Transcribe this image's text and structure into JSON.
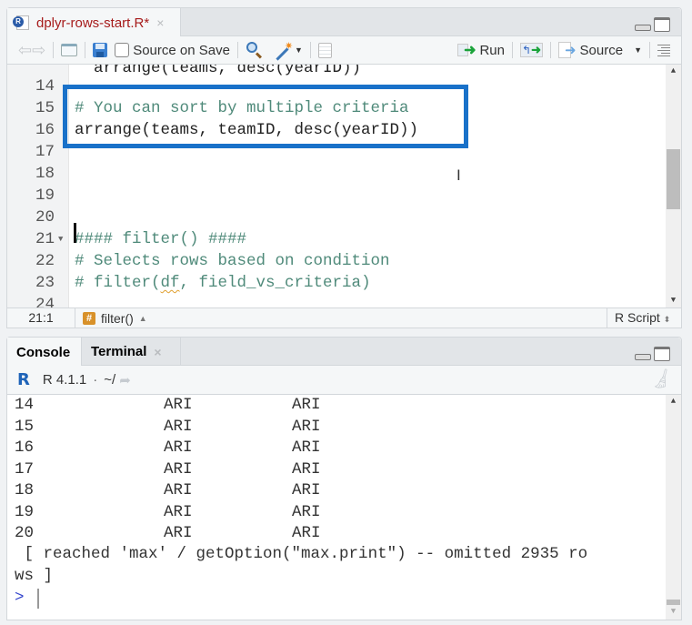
{
  "editor": {
    "tab": {
      "filename": "dplyr-rows-start.R*",
      "close_icon": "×",
      "file_color": "#a61b1b"
    },
    "toolbar": {
      "source_on_save_label": "Source on Save",
      "source_on_save_checked": false,
      "run_label": "Run",
      "source_label": "Source"
    },
    "lines": [
      {
        "n": "14",
        "text": "",
        "kind": "plain"
      },
      {
        "n": "15",
        "text": "# You can sort by multiple criteria",
        "kind": "comment"
      },
      {
        "n": "16",
        "text": "arrange(teams, teamID, desc(yearID))",
        "kind": "plain"
      },
      {
        "n": "17",
        "text": "",
        "kind": "plain"
      },
      {
        "n": "18",
        "text": "",
        "kind": "plain"
      },
      {
        "n": "19",
        "text": "",
        "kind": "plain"
      },
      {
        "n": "20",
        "text": "",
        "kind": "plain"
      },
      {
        "n": "21",
        "text": "#### filter() ####",
        "kind": "comment"
      },
      {
        "n": "22",
        "text": "# Selects rows based on condition",
        "kind": "comment"
      },
      {
        "n": "23",
        "text": "# filter(df, field_vs_criteria)",
        "kind": "comment"
      },
      {
        "n": "24",
        "text": "",
        "kind": "plain"
      }
    ],
    "highlight_color": "#1971c9",
    "status": {
      "position": "21:1",
      "scope": "filter()",
      "language": "R Script"
    }
  },
  "console": {
    "tabs": [
      {
        "label": "Console",
        "active": true
      },
      {
        "label": "Terminal",
        "active": false,
        "close_icon": "×"
      }
    ],
    "r_version": "R 4.1.1",
    "working_dir": "~/",
    "output_rows": [
      {
        "idx": "14",
        "col1": "ARI",
        "col2": "ARI"
      },
      {
        "idx": "15",
        "col1": "ARI",
        "col2": "ARI"
      },
      {
        "idx": "16",
        "col1": "ARI",
        "col2": "ARI"
      },
      {
        "idx": "17",
        "col1": "ARI",
        "col2": "ARI"
      },
      {
        "idx": "18",
        "col1": "ARI",
        "col2": "ARI"
      },
      {
        "idx": "19",
        "col1": "ARI",
        "col2": "ARI"
      },
      {
        "idx": "20",
        "col1": "ARI",
        "col2": "ARI"
      }
    ],
    "message_line1": " [ reached 'max' / getOption(\"max.print\") -- omitted 2935 ro",
    "message_line2": "ws ]",
    "prompt": ">"
  }
}
